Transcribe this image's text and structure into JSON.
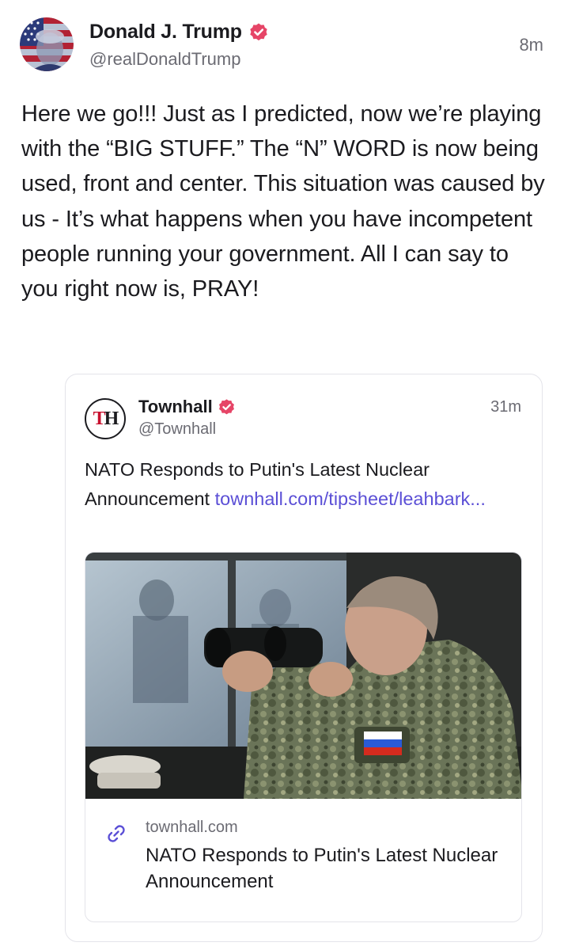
{
  "post": {
    "author": {
      "name": "Donald J. Trump",
      "handle": "@realDonaldTrump",
      "avatar_icon": "flag-portrait-avatar",
      "verified_icon": "verified-badge-icon"
    },
    "time": "8m",
    "text": "Here we go!!! Just as I predicted, now we’re playing with the “BIG STUFF.” The “N” WORD is now being used, front and center. This situation was caused by us - It’s what happens when you have incompetent people running your government. All I can say to you right now is, PRAY!"
  },
  "quote": {
    "author": {
      "name": "Townhall",
      "handle": "@Townhall",
      "avatar_text_t": "T",
      "avatar_text_h": "H",
      "verified_icon": "verified-badge-icon"
    },
    "time": "31m",
    "text": "NATO Responds to Putin's Latest Nuclear Announcement",
    "link_text": "townhall.com/tipsheet/leahbark...",
    "link_card": {
      "image_icon": "news-photo-binoculars",
      "link_icon": "chain-link-icon",
      "domain": "townhall.com",
      "title": "NATO Responds to Putin's Latest Nuclear Announcement"
    }
  },
  "colors": {
    "verified_badge": "#e64567",
    "link": "#5b4fd6",
    "muted": "#6b6b73",
    "text": "#1b1b1f"
  }
}
